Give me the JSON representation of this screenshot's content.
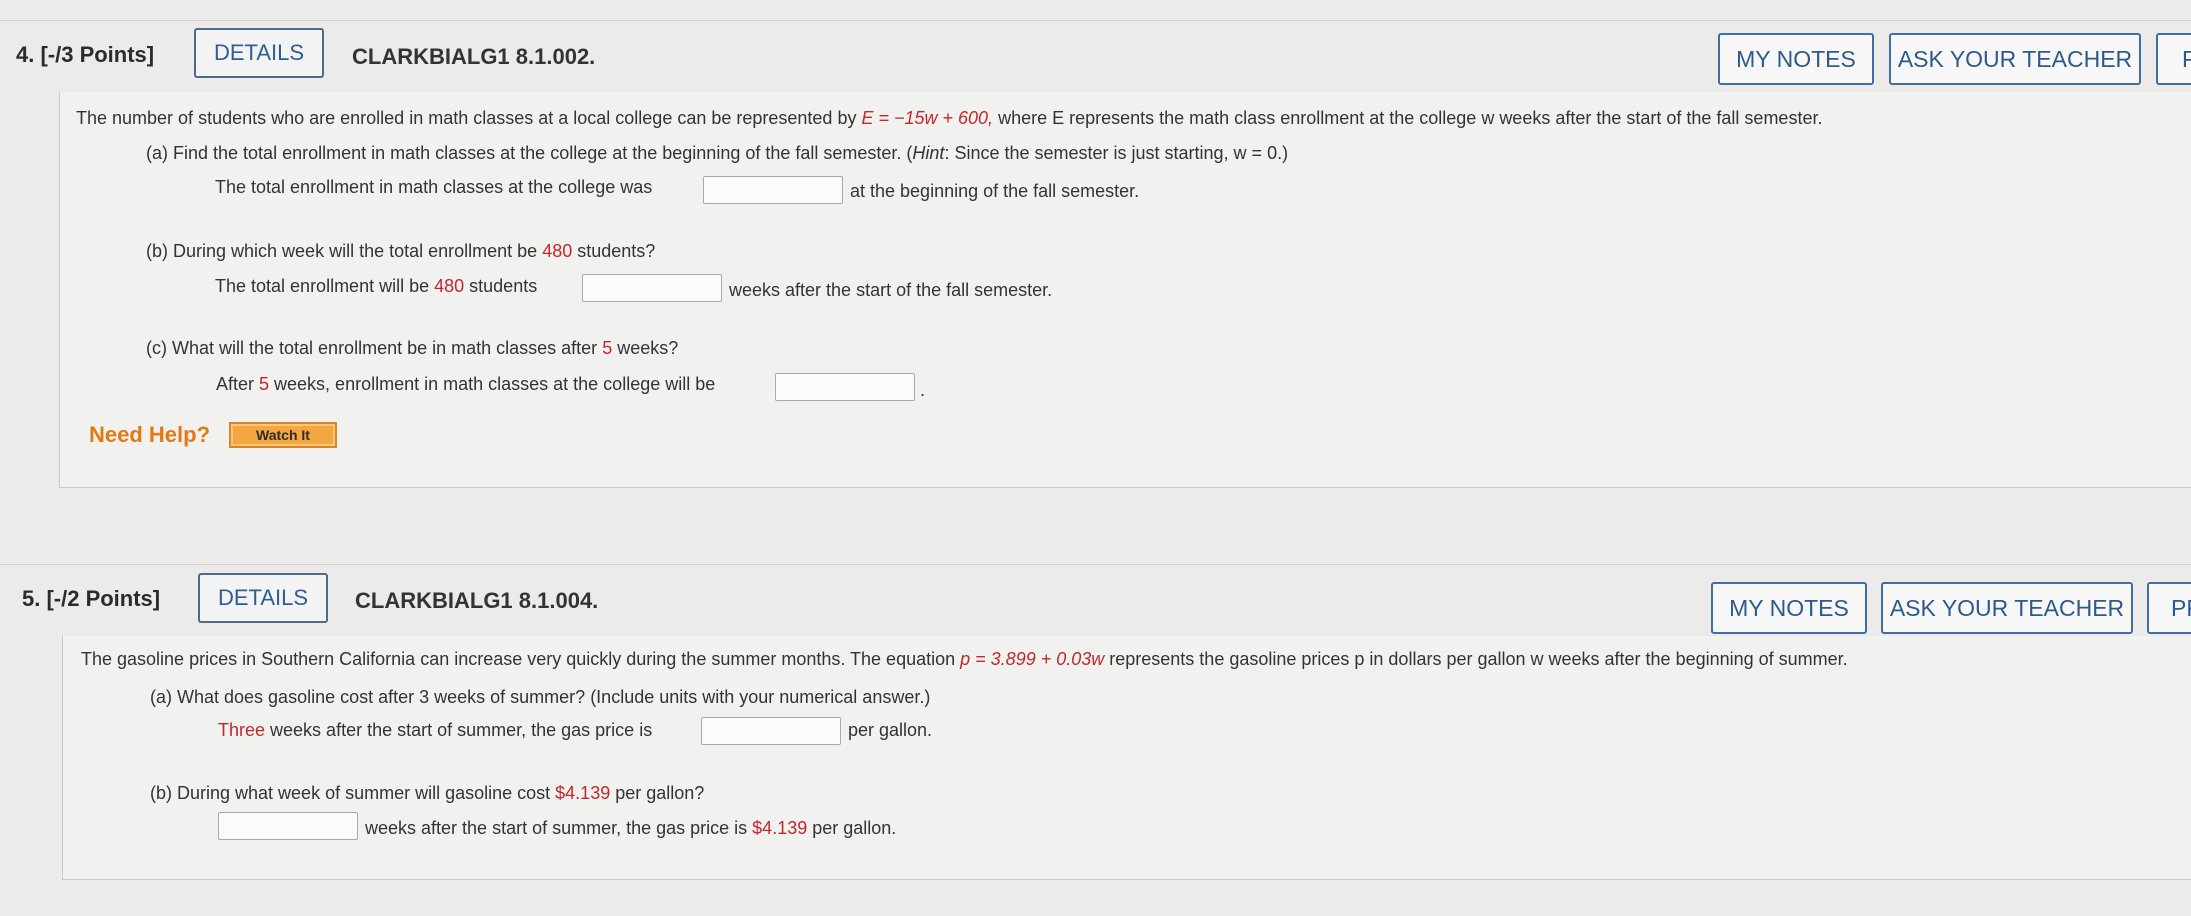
{
  "q4": {
    "number": "4. [-/3 Points]",
    "details_label": "DETAILS",
    "code": "CLARKBIALG1 8.1.002.",
    "my_notes": "MY NOTES",
    "ask_teacher": "ASK YOUR TEACHER",
    "practice_partial": "P",
    "intro_a": "The number of students who are enrolled in math classes at a local college can be represented by ",
    "intro_eq": "E = −15w + 600,",
    "intro_b": " where E represents the math class enrollment at the college w weeks after the start of the fall semester.",
    "part_a_q1": "(a) Find the total enrollment in math classes at the college at the beginning of the fall semester. (",
    "part_a_hint": "Hint",
    "part_a_q2": ": Since the semester is just starting, w = 0.)",
    "part_a_pre": "The total enrollment in math classes at the college was",
    "part_a_post": "at the beginning of the fall semester.",
    "part_b_q1": "(b) During which week will the total enrollment be ",
    "part_b_num": "480",
    "part_b_q2": " students?",
    "part_b_pre1": "The total enrollment will be ",
    "part_b_pre2": " students",
    "part_b_post": "weeks after the start of the fall semester.",
    "part_c_q1": "(c) What will the total enrollment be in math classes after ",
    "part_c_num": "5",
    "part_c_q2": " weeks?",
    "part_c_pre1": "After ",
    "part_c_pre2": " weeks, enrollment in math classes at the college will be",
    "part_c_post": ".",
    "need_help": "Need Help?",
    "watch_it": "Watch It"
  },
  "q5": {
    "number": "5. [-/2 Points]",
    "details_label": "DETAILS",
    "code": "CLARKBIALG1 8.1.004.",
    "my_notes": "MY NOTES",
    "ask_teacher": "ASK YOUR TEACHER",
    "practice_partial": "PF",
    "intro_a": "The gasoline prices in Southern California can increase very quickly during the summer months. The equation ",
    "intro_eq": "p = 3.899 + 0.03w",
    "intro_b": " represents the gasoline prices p in dollars per gallon w weeks after the beginning of summer.",
    "part_a_q": "(a) What does gasoline cost after 3 weeks of summer? (Include units with your numerical answer.)",
    "part_a_pre_red": "Three",
    "part_a_pre": " weeks after the start of summer, the gas price is",
    "part_a_post": "per gallon.",
    "part_b_q1": "(b) During what week of summer will gasoline cost ",
    "part_b_num": "$4.139",
    "part_b_q2": " per gallon?",
    "part_b_post1": "weeks after the start of summer, the gas price is ",
    "part_b_post2": " per gallon."
  }
}
